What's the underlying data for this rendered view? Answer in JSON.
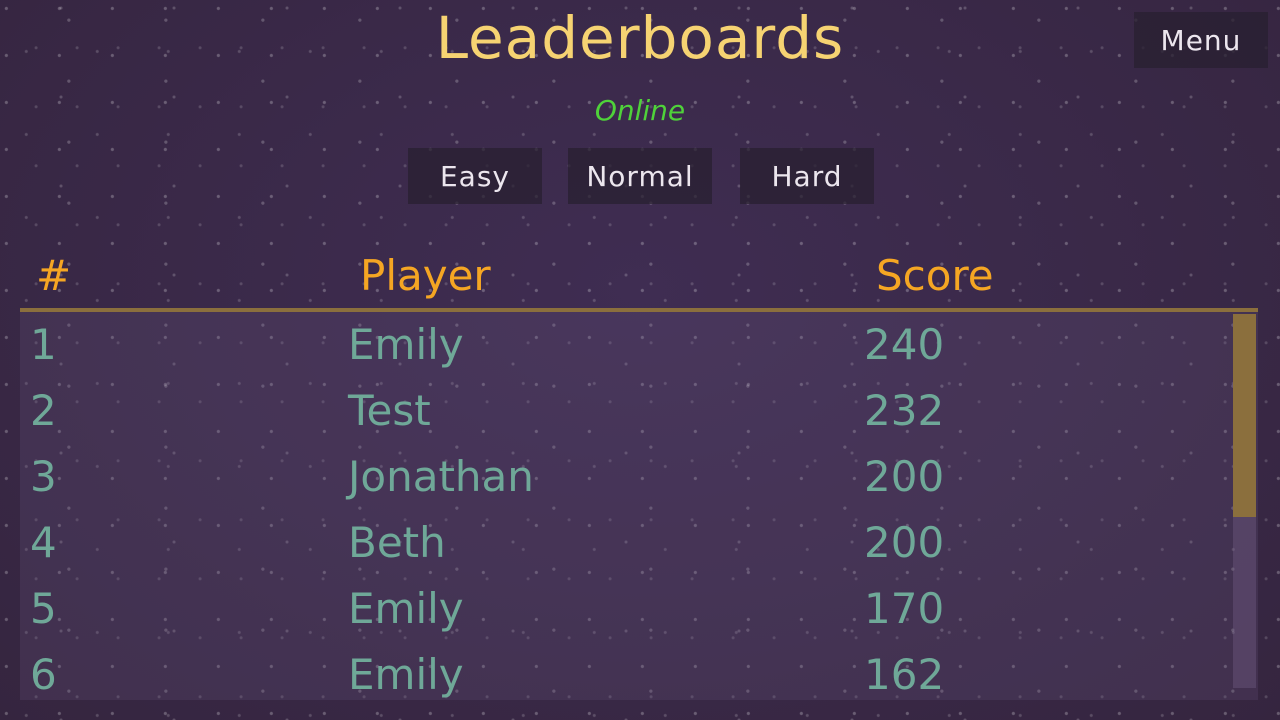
{
  "title": "Leaderboards",
  "menu_label": "Menu",
  "status": "Online",
  "difficulties": {
    "easy": "Easy",
    "normal": "Normal",
    "hard": "Hard"
  },
  "columns": {
    "rank": "#",
    "player": "Player",
    "score": "Score"
  },
  "rows": [
    {
      "rank": "1",
      "player": "Emily",
      "score": "240"
    },
    {
      "rank": "2",
      "player": "Test",
      "score": "232"
    },
    {
      "rank": "3",
      "player": "Jonathan",
      "score": "200"
    },
    {
      "rank": "4",
      "player": "Beth",
      "score": "200"
    },
    {
      "rank": "5",
      "player": "Emily",
      "score": "170"
    },
    {
      "rank": "6",
      "player": "Emily",
      "score": "162"
    }
  ],
  "colors": {
    "title": "#f6d372",
    "status_online": "#4fd23a",
    "column_header": "#f5a623",
    "row_text": "#6fa898",
    "accent_rule": "#8b6f3d",
    "background": "#3b2a4c"
  }
}
